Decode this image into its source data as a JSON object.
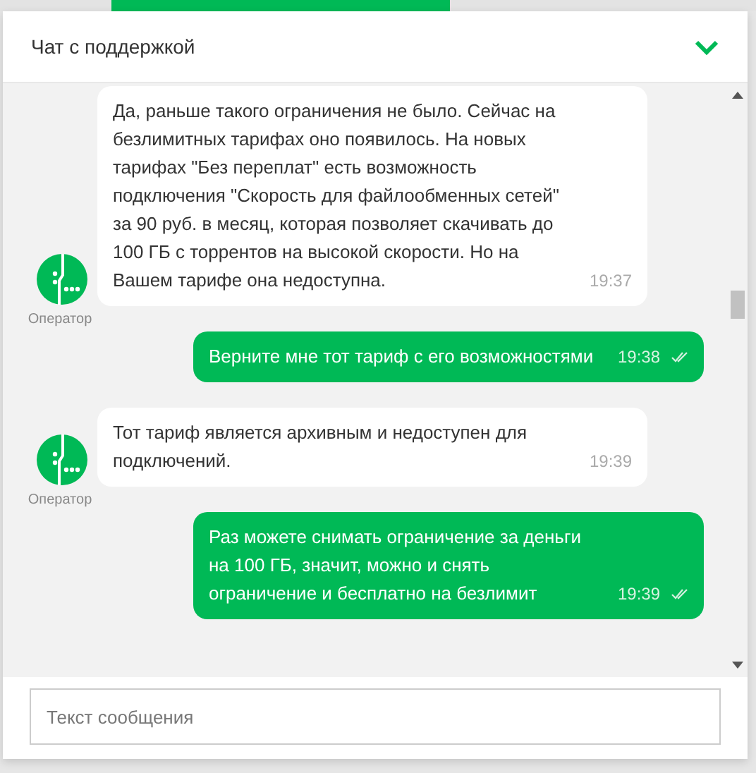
{
  "header": {
    "title": "Чат с поддержкой",
    "expanded": true
  },
  "messages": [
    {
      "kind": "operator",
      "text": "Да, раньше такого ограничения не было. Сейчас на безлимитных тарифах оно появилось. На новых тарифах \"Без переплат\" есть возможность подключения \"Скорость для файлообменных сетей\" за 90 руб. в месяц, которая позволяет скачивать до 100 ГБ с торрентов на высокой скорости. Но на Вашем тарифе она недоступна.",
      "time": "19:37",
      "sender": "Оператор"
    },
    {
      "kind": "user",
      "text": "Верните мне тот тариф с его возможностями",
      "time": "19:38",
      "read": true
    },
    {
      "kind": "operator",
      "text": "Тот тариф является архивным и недоступен для подключений.",
      "time": "19:39",
      "sender": "Оператор"
    },
    {
      "kind": "user",
      "text": "Раз можете снимать ограничение за деньги на 100 ГБ, значит, можно и снять ограничение и бесплатно на безлимит",
      "time": "19:39",
      "read": true
    }
  ],
  "composer": {
    "placeholder": "Текст сообщения"
  }
}
